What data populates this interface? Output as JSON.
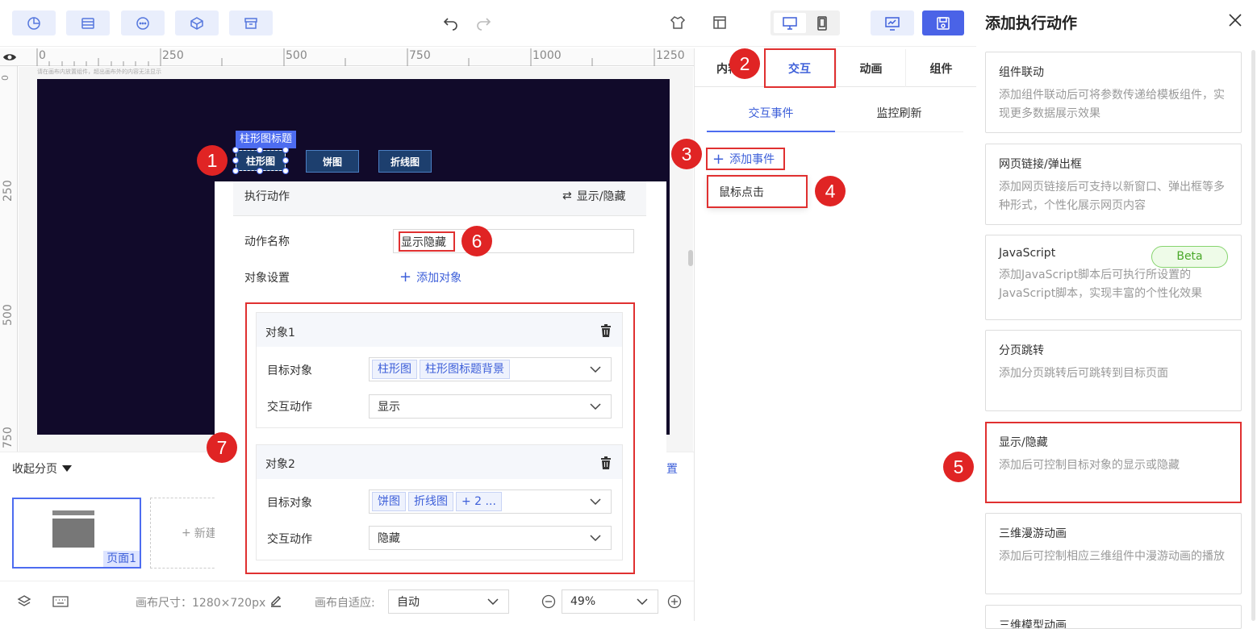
{
  "toolbar": {
    "icons": [
      "chart-pie-icon",
      "storage-icon",
      "more-dots-icon",
      "cube-icon",
      "archive-icon"
    ],
    "undo": "undo-icon",
    "redo": "redo-icon",
    "right_icons": [
      "theme-icon",
      "settings-grid-icon",
      "desktop-icon",
      "mobile-icon",
      "preview-icon",
      "save-icon"
    ]
  },
  "ruler": {
    "h": [
      "0",
      "250",
      "500",
      "750",
      "1000",
      "1250"
    ],
    "v": [
      "0",
      "250",
      "500",
      "750"
    ],
    "hint": "请在画布内放置组件，超出画布外的内容无法显示"
  },
  "canvas": {
    "title_tag": "柱形图标题",
    "chips": [
      "柱形图",
      "饼图",
      "折线图"
    ]
  },
  "callouts": [
    "1",
    "2",
    "3",
    "4",
    "5",
    "6",
    "7"
  ],
  "mid_tabs": [
    "内容",
    "交互",
    "动画",
    "组件"
  ],
  "sub_tabs": [
    "交互事件",
    "监控刷新"
  ],
  "add_event": "添加事件",
  "mouse_click": "鼠标点击",
  "action_panel": {
    "header": "执行动作",
    "switch_label": "显示/隐藏",
    "name_label": "动作名称",
    "name_value": "显示隐藏",
    "target_label": "对象设置",
    "add_target": "添加对象",
    "objects": [
      {
        "title": "对象1",
        "target_label": "目标对象",
        "tags": [
          "柱形图",
          "柱形图标题背景"
        ],
        "action_label": "交互动作",
        "action": "显示"
      },
      {
        "title": "对象2",
        "target_label": "目标对象",
        "tags": [
          "饼图",
          "折线图",
          "+ 2 ..."
        ],
        "action_label": "交互动作",
        "action": "隐藏"
      }
    ]
  },
  "pages": {
    "collapse": "收起分页",
    "thumb_label": "页面1",
    "new_page": "新建",
    "right_link": "置"
  },
  "status": {
    "canvas_size": "画布尺寸：1280×720px",
    "fit_label": "画布自适应:",
    "fit_value": "自动",
    "zoom": "49%"
  },
  "drawer": {
    "title": "添加执行动作",
    "cards": [
      {
        "title": "组件联动",
        "desc": "添加组件联动后可将参数传递给模板组件，实现更多数据展示效果"
      },
      {
        "title": "网页链接/弹出框",
        "desc": "添加网页链接后可支持以新窗口、弹出框等多种形式，个性化展示网页内容"
      },
      {
        "title": "JavaScript",
        "badge": "Beta",
        "desc": "添加JavaScript脚本后可执行所设置的JavaScript脚本，实现丰富的个性化效果"
      },
      {
        "title": "分页跳转",
        "desc": "添加分页跳转后可跳转到目标页面"
      },
      {
        "title": "显示/隐藏",
        "desc": "添加后可控制目标对象的显示或隐藏"
      },
      {
        "title": "三维漫游动画",
        "desc": "添加后可控制相应三维组件中漫游动画的播放"
      },
      {
        "title": "三维模型动画",
        "desc": ""
      }
    ]
  },
  "colors": {
    "accent": "#3d5fd9",
    "callout": "#e02424",
    "canvas_bg": "#110a2a"
  }
}
